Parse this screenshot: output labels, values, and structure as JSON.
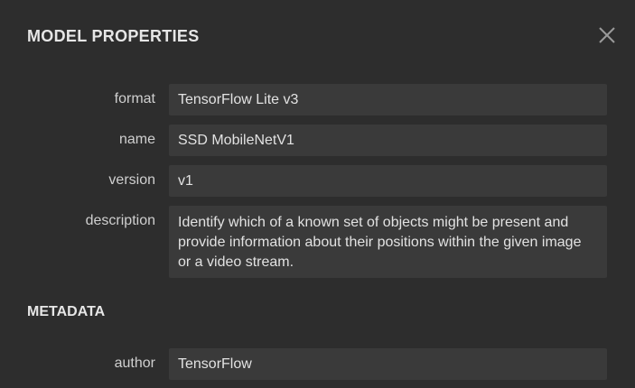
{
  "dialog": {
    "title": "MODEL PROPERTIES",
    "close_icon": "close-icon"
  },
  "properties": {
    "format": {
      "label": "format",
      "value": "TensorFlow Lite v3"
    },
    "name": {
      "label": "name",
      "value": "SSD MobileNetV1"
    },
    "version": {
      "label": "version",
      "value": "v1"
    },
    "description": {
      "label": "description",
      "value": "Identify which of a known set of objects might be present and provide information about their positions within the given image or a video stream."
    }
  },
  "metadata": {
    "heading": "METADATA",
    "author": {
      "label": "author",
      "value": "TensorFlow"
    }
  },
  "colors": {
    "background": "#2d2d2d",
    "field": "#3a3a3a",
    "text": "#e2e2e2"
  }
}
